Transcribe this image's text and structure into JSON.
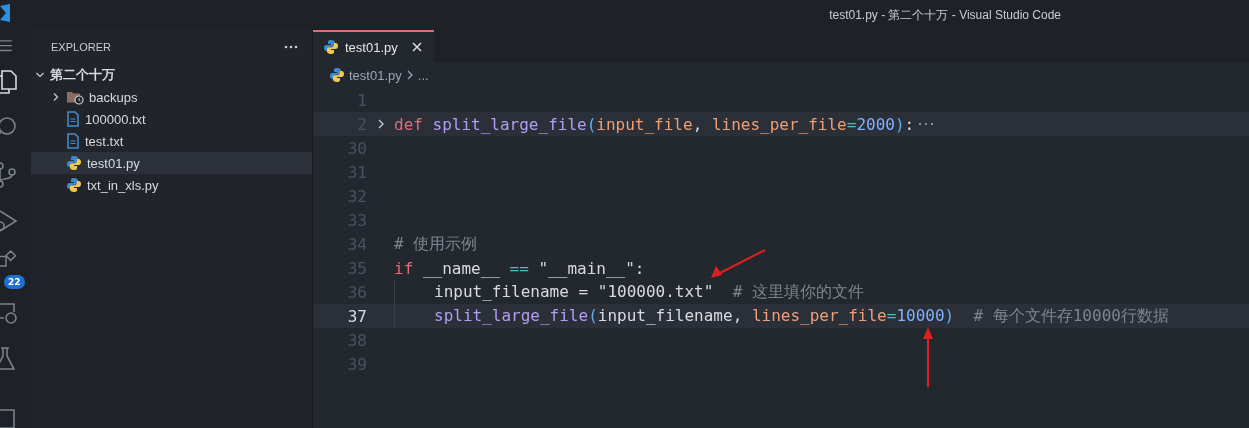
{
  "window": {
    "title": "test01.py - 第二个十万 - Visual Studio Code"
  },
  "activity_bar": {
    "items": [
      {
        "kind": "explorer",
        "selected": true
      },
      {
        "kind": "search",
        "selected": false
      },
      {
        "kind": "source-control",
        "selected": false
      },
      {
        "kind": "run",
        "selected": false
      },
      {
        "kind": "extensions",
        "selected": false,
        "badge": "22"
      },
      {
        "kind": "remote",
        "selected": false
      },
      {
        "kind": "testing",
        "selected": false
      },
      {
        "kind": "window",
        "selected": false
      }
    ]
  },
  "sidebar": {
    "title": "EXPLORER",
    "tree": {
      "label": "第二个十万",
      "expanded": true,
      "children": [
        {
          "label": "backups",
          "kind": "folder",
          "expanded": false,
          "selected": false
        },
        {
          "label": "100000.txt",
          "kind": "text",
          "selected": false
        },
        {
          "label": "test.txt",
          "kind": "text",
          "selected": false
        },
        {
          "label": "test01.py",
          "kind": "python",
          "selected": true
        },
        {
          "label": "txt_in_xls.py",
          "kind": "python",
          "selected": false
        }
      ]
    }
  },
  "tabs": [
    {
      "label": "test01.py",
      "selected": true
    }
  ],
  "breadcrumb": [
    "test01.py",
    "..."
  ],
  "editor": {
    "lines": [
      {
        "number": "1",
        "current": false
      },
      {
        "number": "2",
        "current": false,
        "folded": true,
        "tokens": [
          {
            "kind": "keyword",
            "text": "def "
          },
          {
            "kind": "function",
            "text": "split_large_file"
          },
          {
            "kind": "paren",
            "text": "("
          },
          {
            "kind": "param",
            "text": "input_file"
          },
          {
            "kind": "plain",
            "text": ", "
          },
          {
            "kind": "param",
            "text": "lines_per_file"
          },
          {
            "kind": "operator",
            "text": "="
          },
          {
            "kind": "number",
            "text": "2000"
          },
          {
            "kind": "paren",
            "text": ")"
          },
          {
            "kind": "plain",
            "text": ":"
          }
        ]
      },
      {
        "number": "30",
        "current": false
      },
      {
        "number": "31",
        "current": false
      },
      {
        "number": "32",
        "current": false
      },
      {
        "number": "33",
        "current": false
      },
      {
        "number": "34",
        "current": false,
        "tokens": [
          {
            "kind": "comment",
            "text": "# 使用示例"
          }
        ]
      },
      {
        "number": "35",
        "current": false,
        "tokens": [
          {
            "kind": "keyword",
            "text": "if"
          },
          {
            "kind": "plain",
            "text": " __name__ "
          },
          {
            "kind": "operator",
            "text": "== "
          },
          {
            "kind": "string",
            "text": "\"__main__\""
          },
          {
            "kind": "plain",
            "text": ":"
          }
        ]
      },
      {
        "number": "36",
        "current": false,
        "indented": true,
        "tokens": [
          {
            "kind": "plain",
            "text": "input_filename = "
          },
          {
            "kind": "string",
            "text": "\"100000.txt\""
          },
          {
            "kind": "comment",
            "text": "  # 这里填你的文件"
          }
        ]
      },
      {
        "number": "37",
        "current": true,
        "indented": true,
        "tokens": [
          {
            "kind": "function",
            "text": "split_large_file"
          },
          {
            "kind": "paren",
            "text": "("
          },
          {
            "kind": "plain",
            "text": "input_filename, "
          },
          {
            "kind": "param",
            "text": "lines_per_file"
          },
          {
            "kind": "operator",
            "text": "="
          },
          {
            "kind": "number",
            "text": "10000"
          },
          {
            "kind": "paren",
            "text": ")"
          },
          {
            "kind": "comment",
            "text": "  # 每个文件存10000行数据"
          }
        ]
      },
      {
        "number": "38",
        "current": false
      },
      {
        "number": "39",
        "current": false
      }
    ]
  }
}
